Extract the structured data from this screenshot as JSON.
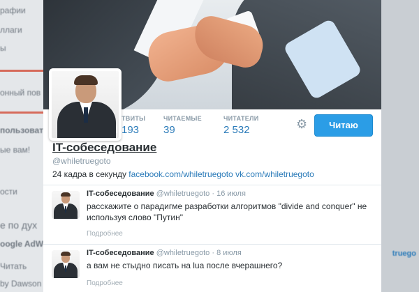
{
  "background_page": {
    "left_items": [
      "рафии",
      "ллаги",
      "ы",
      "онный пов",
      "пользовател",
      "ые вам!",
      "ости",
      "е по дух",
      "oogle AdWo",
      "Читать",
      "by Dawson"
    ],
    "right_items": [
      "truego"
    ]
  },
  "profile": {
    "name": "IT-собеседование",
    "handle": "@whiletruegoto",
    "bio_text": "24 кадра в секунду",
    "bio_link1": "facebook.com/whiletruegoto",
    "bio_link2": "vk.com/whiletruegoto",
    "follow_label": "Читаю",
    "stats": [
      {
        "label": "ТВИТЫ",
        "value": "193"
      },
      {
        "label": "ЧИТАЕМЫЕ",
        "value": "39"
      },
      {
        "label": "ЧИТАТЕЛИ",
        "value": "2 532"
      }
    ]
  },
  "tweets": [
    {
      "name": "IT-собеседование",
      "handle": "@whiletruegoto",
      "sep": "·",
      "date": "16 июля",
      "text": "расскажите о парадигме разработки алгоритмов \"divide and conquer\" не используя слово \"Путин\"",
      "more": "Подробнее"
    },
    {
      "name": "IT-собеседование",
      "handle": "@whiletruegoto",
      "sep": "·",
      "date": "8 июля",
      "text": "а вам не стыдно писать на lua после вчерашнего?",
      "more": "Подробнее"
    }
  ],
  "colors": {
    "accent": "#2b7bb9",
    "button": "#2b9de6"
  }
}
